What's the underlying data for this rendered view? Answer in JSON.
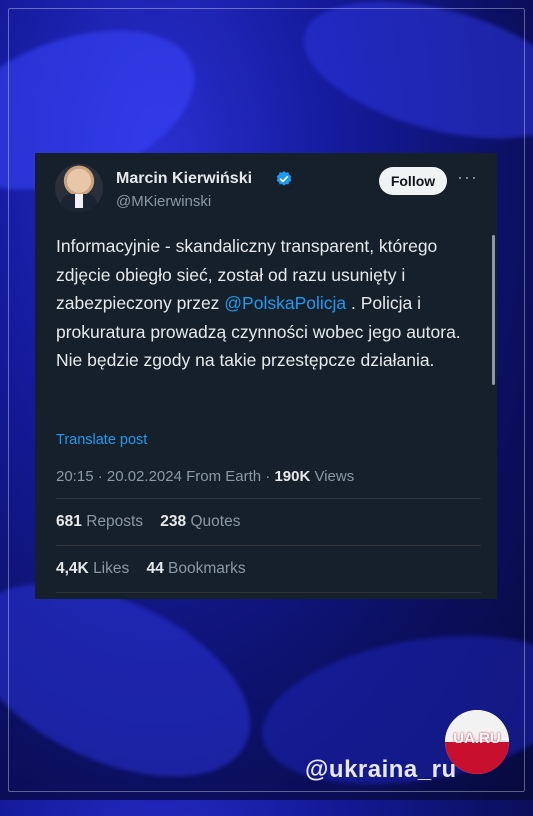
{
  "author": {
    "name": "Marcin Kierwiński",
    "handle": "@MKierwinski",
    "verified": true
  },
  "follow_label": "Follow",
  "more_label": "···",
  "post": {
    "text_before": "Informacyjnie - skandaliczny transparent, którego zdjęcie obiegło sieć, został od razu usunięty i zabezpieczony przez ",
    "mention": "@PolskaPolicja",
    "text_after": " . Policja i prokuratura prowadzą czynności wobec jego autora. Nie będzie zgody na takie przestępcze działania.",
    "translate_label": "Translate post",
    "time": "20:15 · 20.02.2024 From Earth · ",
    "views_count": "190K",
    "views_label": " Views"
  },
  "stats": {
    "reposts_count": "681",
    "reposts_label": "Reposts",
    "quotes_count": "238",
    "quotes_label": "Quotes",
    "likes_count": "4,4K",
    "likes_label": "Likes",
    "bookmarks_count": "44",
    "bookmarks_label": "Bookmarks"
  },
  "watermark": "@ukraina_ru",
  "logo_text": "UA.RU",
  "colors": {
    "card_bg": "#15202b",
    "link": "#1d9bf0",
    "verified": "#1d9bf0",
    "background": "#141a9a"
  }
}
